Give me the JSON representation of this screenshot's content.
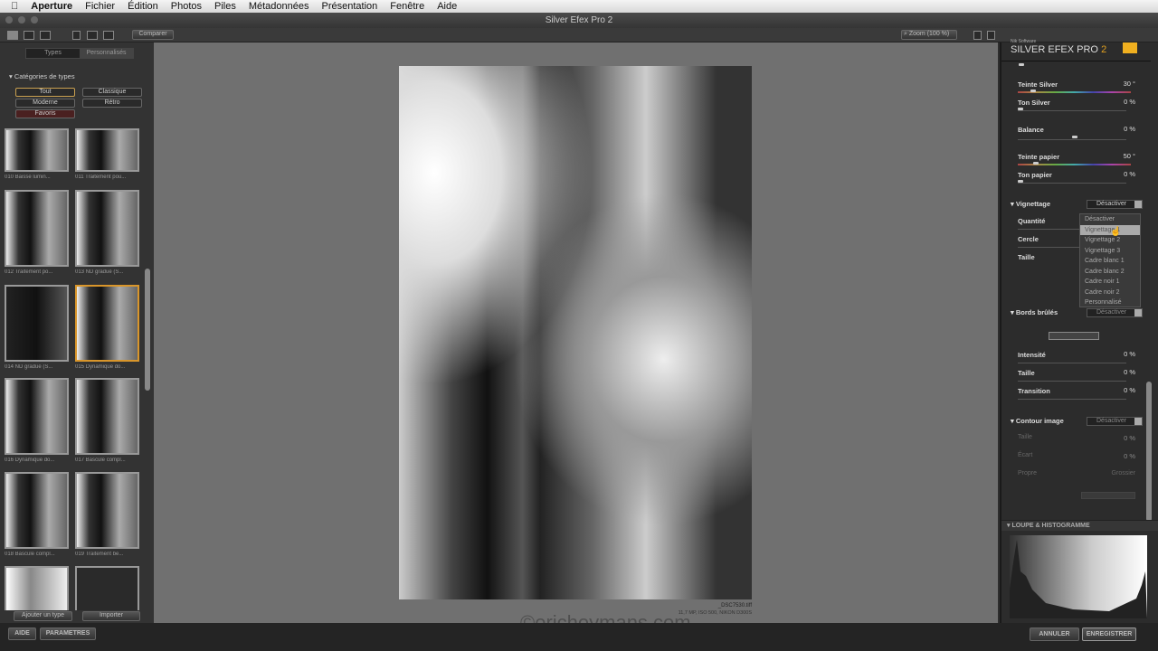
{
  "menubar": {
    "apple_icon": "apple-icon",
    "items": [
      "Aperture",
      "Fichier",
      "Édition",
      "Photos",
      "Piles",
      "Métadonnées",
      "Présentation",
      "Fenêtre",
      "Aide"
    ]
  },
  "window": {
    "title": "Silver Efex Pro 2"
  },
  "toolbar": {
    "compare": "Comparer",
    "zoom": "Zoom (100 %)"
  },
  "left": {
    "tabs": [
      "Types",
      "Personnalisés"
    ],
    "categories_title": "Catégories de types",
    "categories": [
      "Tout",
      "Classique",
      "Moderne",
      "Rétro",
      "Favoris"
    ],
    "thumbs": [
      "010 Baisse lumin...",
      "011 Traitement pou...",
      "012 Traitement po...",
      "013 ND gradué (S...",
      "014 ND gradué (S...",
      "015 Dynamique do...",
      "016 Dynamique do...",
      "017 Bascule compl...",
      "018 Bascule compl...",
      "019 Traitement be...",
      "",
      ""
    ],
    "add_type": "Ajouter un type",
    "import": "Importer"
  },
  "photo": {
    "filename": "_DSC7530.tiff",
    "info": "11,7 MP, ISO 500, NIKON D300S",
    "watermark": "©ericheymans.com"
  },
  "right": {
    "brand_small": "Nik Software",
    "brand": "SILVER EFEX PRO",
    "brand_version": "2",
    "sliders": [
      {
        "label": "Teinte Silver",
        "value": "30",
        "unit": "°",
        "pos": 0.15
      },
      {
        "label": "Ton Silver",
        "value": "0",
        "unit": "%",
        "pos": 0
      },
      {
        "label": "Balance",
        "value": "0",
        "unit": "%",
        "pos": 0.5
      },
      {
        "label": "Teinte papier",
        "value": "50",
        "unit": "°",
        "pos": 0.12
      },
      {
        "label": "Ton papier",
        "value": "0",
        "unit": "%",
        "pos": 0
      }
    ],
    "vignette": {
      "title": "Vignettage",
      "value": "Désactiver",
      "rows": [
        "Quantité",
        "Cercle",
        "Taille"
      ],
      "menu": [
        "Désactiver",
        "Vignettage 1",
        "Vignettage 2",
        "Vignettage 3",
        "Cadre blanc 1",
        "Cadre blanc 2",
        "Cadre noir 1",
        "Cadre noir 2",
        "Personnalisé"
      ],
      "highlighted": "Vignettage 1"
    },
    "burn": {
      "title": "Bords brûlés",
      "value": "Désactiver",
      "rows": [
        {
          "label": "Intensité",
          "value": "0",
          "unit": "%"
        },
        {
          "label": "Taille",
          "value": "0",
          "unit": "%"
        },
        {
          "label": "Transition",
          "value": "0",
          "unit": "%"
        }
      ]
    },
    "contour": {
      "title": "Contour image",
      "value": "Désactiver",
      "rows": [
        {
          "label": "Taille",
          "value": "0",
          "unit": "%"
        },
        {
          "label": "Écart",
          "value": "0",
          "unit": "%"
        },
        {
          "label": "Propre",
          "value": "Grossier",
          "unit": ""
        }
      ]
    },
    "loupe": "LOUPE & HISTOGRAMME"
  },
  "bottom": {
    "help": "AIDE",
    "settings": "PARAMETRES",
    "cancel": "ANNULER",
    "save": "ENREGISTRER"
  }
}
